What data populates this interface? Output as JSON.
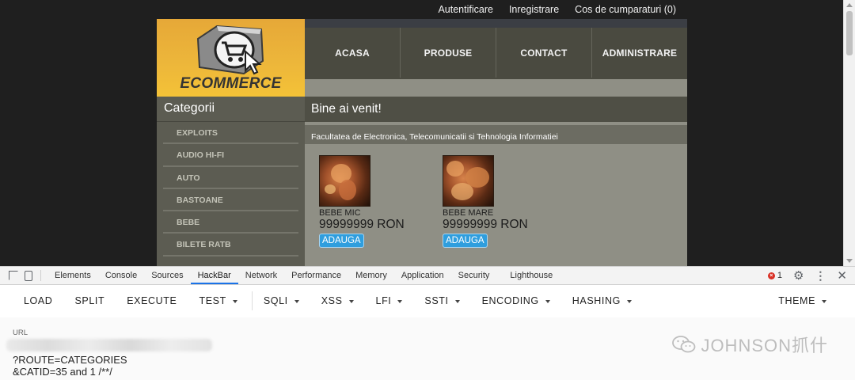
{
  "topnav": {
    "login": "Autentificare",
    "register": "Inregistrare",
    "cart": "Cos de cumparaturi (0)"
  },
  "logo": {
    "text": "ECOMMERCE"
  },
  "mainnav": [
    "ACASA",
    "PRODUSE",
    "CONTACT",
    "ADMINISTRARE"
  ],
  "sidebar": {
    "title": "Categorii",
    "items": [
      "EXPLOITS",
      "AUDIO HI-FI",
      "AUTO",
      "BASTOANE",
      "BEBE",
      "BILETE RATB"
    ]
  },
  "content": {
    "welcome": "Bine ai venit!",
    "subtitle": "Facultatea de Electronica, Telecomunicatii si Tehnologia Informatiei",
    "products": [
      {
        "name": "BEBE MIC",
        "price": "99999999 RON",
        "button": "ADAUGA"
      },
      {
        "name": "BEBE MARE",
        "price": "99999999 RON",
        "button": "ADAUGA"
      }
    ]
  },
  "devtools": {
    "tabs": [
      "Elements",
      "Console",
      "Sources",
      "HackBar",
      "Network",
      "Performance",
      "Memory",
      "Application",
      "Security",
      "Lighthouse"
    ],
    "active_tab": "HackBar",
    "error_count": "1"
  },
  "hackbar": {
    "buttons": [
      "LOAD",
      "SPLIT",
      "EXECUTE"
    ],
    "test": "TEST",
    "dropdowns": [
      "SQLI",
      "XSS",
      "LFI",
      "SSTI",
      "ENCODING",
      "HASHING"
    ],
    "theme": "THEME",
    "url_label": "URL",
    "url_line1": "?ROUTE=CATEGORIES",
    "url_line2": "&CATID=35 and 1 /**/"
  },
  "watermark": "JOHNSON抓什",
  "colors": {
    "logo_bg": "#eab03a",
    "nav_bg": "#4a4a40",
    "page_bg": "#8f8f85",
    "sidebar_bg": "#5c5c52",
    "button_blue": "#2f9ede",
    "devtools_accent": "#1a73e8",
    "error_red": "#d93025"
  }
}
